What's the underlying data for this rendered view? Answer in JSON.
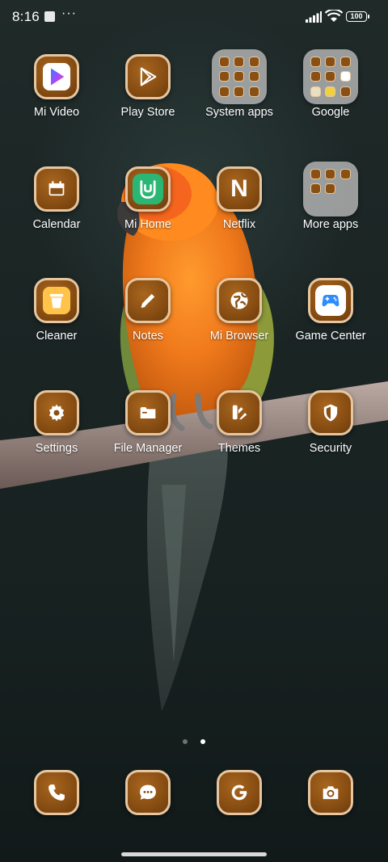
{
  "status_bar": {
    "time": "8:16",
    "more_indicator": "···",
    "battery": "100"
  },
  "apps": {
    "mi_video": "Mi Video",
    "play_store": "Play Store",
    "system_apps": "System apps",
    "google": "Google",
    "calendar": "Calendar",
    "mi_home": "Mi Home",
    "netflix": "Netflix",
    "more_apps": "More apps",
    "cleaner": "Cleaner",
    "notes": "Notes",
    "mi_browser": "Mi Browser",
    "game_center": "Game Center",
    "settings": "Settings",
    "file_manager": "File Manager",
    "themes": "Themes",
    "security": "Security"
  },
  "netflix_glyph": "N",
  "page_indicator": {
    "count": 2,
    "active": 2
  },
  "dock": [
    "phone-icon",
    "messaging-icon",
    "browser-icon",
    "camera-icon"
  ],
  "colors": {
    "icon_brown": "#8a4f13",
    "icon_border": "#e6c6a0",
    "folder_bg": "#bebebe",
    "mi_home_green": "#2bb673"
  }
}
